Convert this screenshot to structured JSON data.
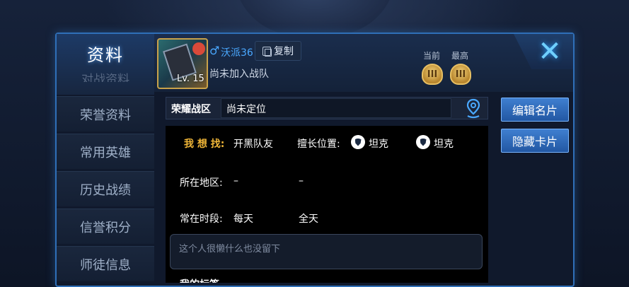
{
  "sidebar": {
    "title": "资料",
    "partial_item": "对战资料",
    "items": [
      {
        "label": "荣誉资料"
      },
      {
        "label": "常用英雄"
      },
      {
        "label": "历史战绩"
      },
      {
        "label": "信誉积分"
      },
      {
        "label": "师徒信息"
      }
    ]
  },
  "profile": {
    "level": "Lv. 15",
    "gender_symbol": "♂",
    "name": "沃派36",
    "copy_label": "复制",
    "team_status": "尚未加入战队"
  },
  "rank": {
    "current_label": "当前",
    "highest_label": "最高",
    "current_badge": "III",
    "highest_badge": "III"
  },
  "actions": {
    "edit_card": "编辑名片",
    "hide_card": "隐藏卡片"
  },
  "honor_zone": {
    "label": "荣耀战区",
    "value": "尚未定位"
  },
  "info": {
    "looking_for_label": "我 想 找:",
    "looking_for_value": "开黑队友",
    "position_label": "擅长位置:",
    "positions": [
      "坦克",
      "坦克"
    ],
    "region_label": "所在地区:",
    "region_values": [
      "–",
      "–"
    ],
    "time_label": "常在时段:",
    "time_values": [
      "每天",
      "全天"
    ],
    "signature": "这个人很懒什么也没留下",
    "tags_title": "我的标签"
  },
  "colors": {
    "accent_blue": "#2f6fb8",
    "gold": "#f0b638",
    "name_blue": "#4aa8ff"
  }
}
